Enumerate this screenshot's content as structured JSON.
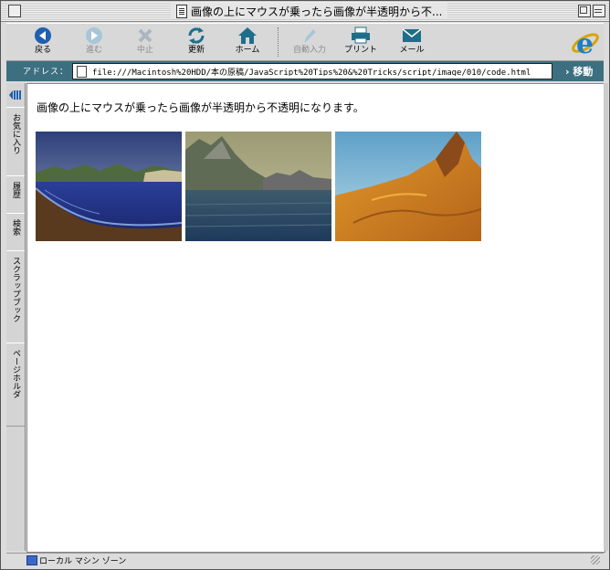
{
  "window": {
    "title": "画像の上にマウスが乗ったら画像が半透明から不..."
  },
  "toolbar": {
    "buttons": [
      {
        "label": "戻る",
        "icon": "back-arrow-icon",
        "enabled": true
      },
      {
        "label": "進む",
        "icon": "forward-arrow-icon",
        "enabled": false
      },
      {
        "label": "中止",
        "icon": "stop-icon",
        "enabled": false
      },
      {
        "label": "更新",
        "icon": "refresh-icon",
        "enabled": true
      },
      {
        "label": "ホーム",
        "icon": "home-icon",
        "enabled": true
      },
      {
        "label": "自動入力",
        "icon": "autofill-icon",
        "enabled": false
      },
      {
        "label": "プリント",
        "icon": "print-icon",
        "enabled": true
      },
      {
        "label": "メール",
        "icon": "mail-icon",
        "enabled": true
      }
    ]
  },
  "address": {
    "label": "アドレス：",
    "url": "file:///Macintosh%20HDD/本の原稿/JavaScript%20Tips%20&%20Tricks/script/image/010/code.html",
    "go_label": "移動"
  },
  "sidebar": {
    "tabs": [
      "お気に入り",
      "履歴",
      "検索",
      "スクラップブック",
      "ページホルダ"
    ]
  },
  "page": {
    "heading": "画像の上にマウスが乗ったら画像が半透明から不透明になります。",
    "images": [
      {
        "name": "coastal-landscape-image"
      },
      {
        "name": "mountain-lake-image"
      },
      {
        "name": "desert-mountain-image"
      }
    ]
  },
  "status": {
    "text": "ローカル マシン ゾーン"
  },
  "colors": {
    "accent": "#1e5fae",
    "addressbar": "#3c6f80"
  }
}
